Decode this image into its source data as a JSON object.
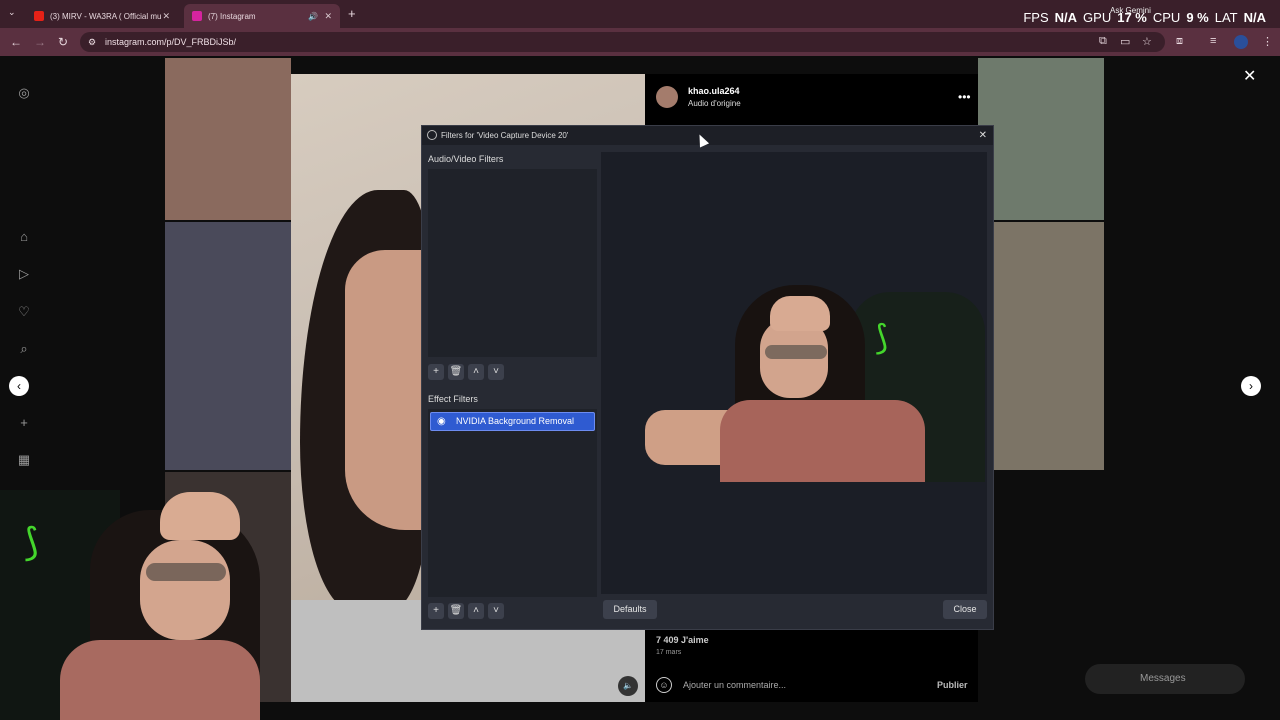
{
  "browser": {
    "tabs": [
      {
        "label": "(3) MIRV - WA3RA ( Official mu"
      },
      {
        "label": "(7) Instagram"
      }
    ],
    "url": "instagram.com/p/DV_FRBDiJSb/",
    "gemini": "Ask Gemini"
  },
  "stats": {
    "fps_label": "FPS",
    "fps_value": "N/A",
    "gpu_label": "GPU",
    "gpu_value": "17 %",
    "cpu_label": "CPU",
    "cpu_value": "9 %",
    "lat_label": "LAT",
    "lat_value": "N/A"
  },
  "post": {
    "username": "khao.ula264",
    "audio": "Audio d'origine",
    "likes": "7 409 J'aime",
    "date": "17 mars",
    "comment_placeholder": "Ajouter un commentaire...",
    "publish": "Publier",
    "messages": "Messages"
  },
  "dialog": {
    "title": "Filters for 'Video Capture Device 20'",
    "av_filters_label": "Audio/Video Filters",
    "effect_filters_label": "Effect Filters",
    "effect_filters": [
      "NVIDIA Background Removal"
    ],
    "defaults_label": "Defaults",
    "close_label": "Close"
  },
  "colors": {
    "selection": "#2f5bd1",
    "razer_green": "#44d62c",
    "browser_frame": "#5a3040"
  }
}
